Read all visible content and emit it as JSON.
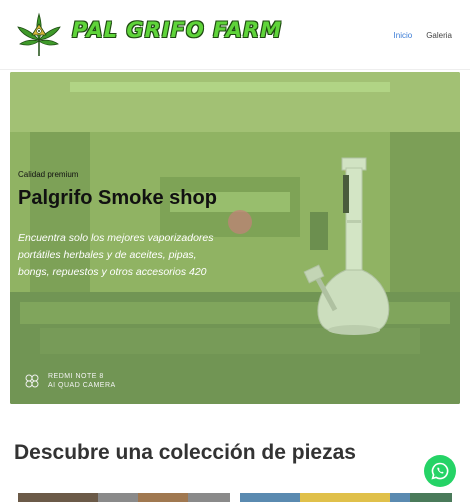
{
  "header": {
    "brand": "PAL GRIFO FARM",
    "nav": [
      {
        "label": "Inicio",
        "active": true
      },
      {
        "label": "Galeria",
        "active": false
      }
    ]
  },
  "hero": {
    "eyebrow": "Calidad premium",
    "title": "Palgrifo Smoke shop",
    "description": "Encuentra solo los mejores vaporizadores portátiles herbales y de aceites, pipas, bongs, repuestos y otros accesorios 420",
    "watermark_line1": "REDMI NOTE 8",
    "watermark_line2": "AI QUAD CAMERA"
  },
  "section": {
    "title": "Descubre una colección de piezas"
  },
  "colors": {
    "brand_green": "#5fd43a",
    "nav_active": "#3a7bd5",
    "whatsapp": "#25d366"
  },
  "icons": {
    "logo": "cannabis-leaf-icon",
    "fab": "whatsapp-icon"
  }
}
